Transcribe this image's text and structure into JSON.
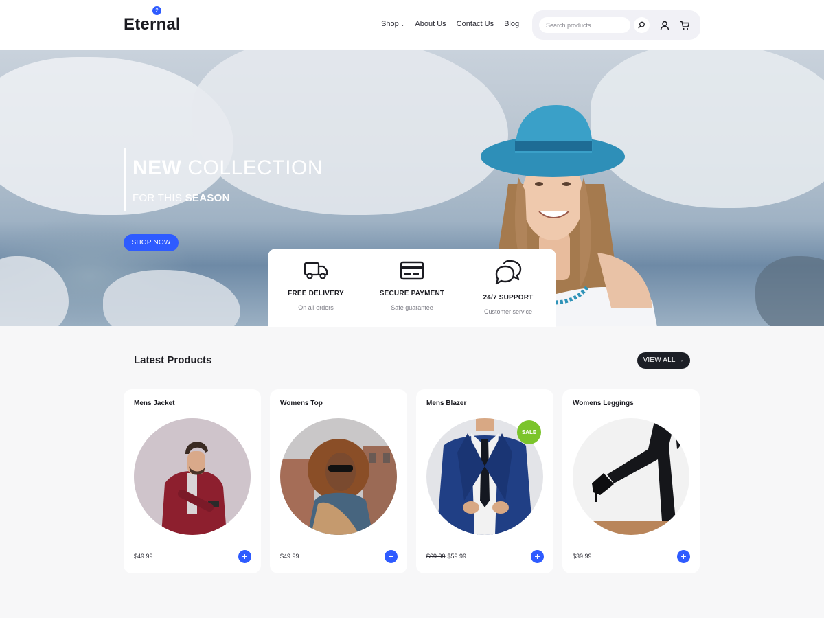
{
  "header": {
    "logo": "Eternal",
    "nav": [
      {
        "label": "Shop",
        "has_dropdown": true
      },
      {
        "label": "About Us"
      },
      {
        "label": "Contact Us"
      },
      {
        "label": "Blog"
      }
    ],
    "search_placeholder": "Search products...",
    "cart_count": "2",
    "icons": [
      "search-icon",
      "user-icon",
      "cart-icon"
    ]
  },
  "hero": {
    "title_bold": "NEW",
    "title_rest": "COLLECTION",
    "sub_light": "FOR THIS",
    "sub_bold": "SEASON",
    "cta": "SHOP NOW"
  },
  "features": [
    {
      "icon": "truck-icon",
      "title": "FREE DELIVERY",
      "sub": "On all orders"
    },
    {
      "icon": "credit-card-icon",
      "title": "SECURE PAYMENT",
      "sub": "Safe guarantee"
    },
    {
      "icon": "chat-bubbles-icon",
      "title": "24/7 SUPPORT",
      "sub": "Customer service"
    }
  ],
  "products_section": {
    "title": "Latest Products",
    "view_all": "VIEW ALL →"
  },
  "products": [
    {
      "name": "Mens Jacket",
      "price": "$49.99",
      "add": "+"
    },
    {
      "name": "Womens Top",
      "price": "$49.99",
      "add": "+"
    },
    {
      "name": "Mens Blazer",
      "old_price": "$69.99",
      "price": "$59.99",
      "badge": "SALE",
      "add": "+"
    },
    {
      "name": "Womens Leggings",
      "price": "$39.99",
      "add": "+"
    }
  ],
  "colors": {
    "accent": "#2e5bff",
    "sale": "#7bc42b",
    "dark_button": "#1c1f26"
  }
}
